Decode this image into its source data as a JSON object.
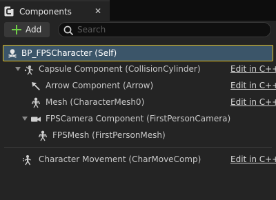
{
  "tab": {
    "title": "Components",
    "close_glyph": "✕",
    "icon": "blueprint-icon"
  },
  "toolbar": {
    "add_label": "Add",
    "search_placeholder": "Search"
  },
  "root": {
    "label": "BP_FPSCharacter (Self)",
    "icon": "character-icon"
  },
  "components": [
    {
      "label": "Capsule Component (CollisionCylinder)",
      "edit": "Edit in C++",
      "icon": "capsule-icon",
      "expanded": true
    },
    {
      "label": "Arrow Component (Arrow)",
      "edit": "Edit in C++",
      "icon": "arrow-icon"
    },
    {
      "label": "Mesh (CharacterMesh0)",
      "edit": "Edit in C++",
      "icon": "skeletal-mesh-icon"
    },
    {
      "label": "FPSCamera Component (FirstPersonCamera)",
      "edit": "",
      "icon": "camera-icon",
      "expanded": true
    },
    {
      "label": "FPSMesh (FirstPersonMesh)",
      "edit": "",
      "icon": "skeletal-mesh-icon"
    }
  ],
  "movement": {
    "label": "Character Movement (CharMoveComp)",
    "edit": "Edit in C++",
    "icon": "movement-icon"
  },
  "colors": {
    "selection": "#3b5569",
    "selection_border": "#e8c01a",
    "add_accent": "#6fd047"
  }
}
